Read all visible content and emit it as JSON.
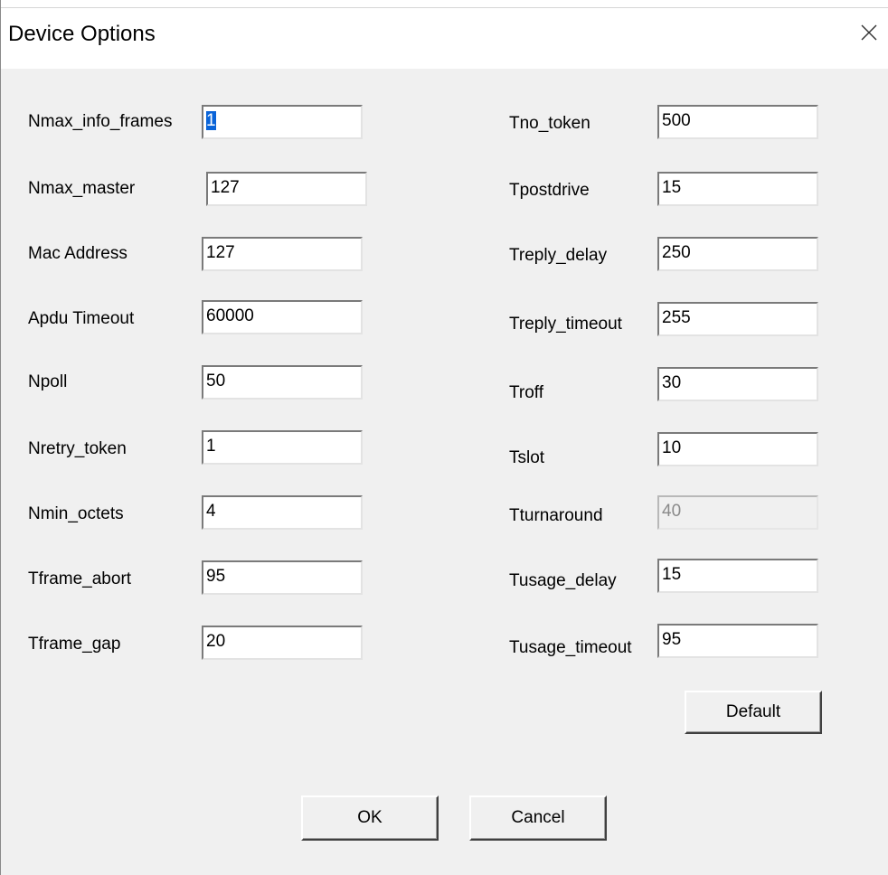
{
  "window": {
    "title": "Device Options",
    "close_icon": "close-icon"
  },
  "left_fields": [
    {
      "label": "Nmax_info_frames",
      "value": "1"
    },
    {
      "label": "Nmax_master",
      "value": "127"
    },
    {
      "label": "Mac Address",
      "value": "127"
    },
    {
      "label": "Apdu Timeout",
      "value": "60000"
    },
    {
      "label": "Npoll",
      "value": "50"
    },
    {
      "label": "Nretry_token",
      "value": "1"
    },
    {
      "label": "Nmin_octets",
      "value": "4"
    },
    {
      "label": "Tframe_abort",
      "value": "95"
    },
    {
      "label": "Tframe_gap",
      "value": "20"
    }
  ],
  "right_fields": [
    {
      "label": "Tno_token",
      "value": "500"
    },
    {
      "label": "Tpostdrive",
      "value": "15"
    },
    {
      "label": "Treply_delay",
      "value": "250"
    },
    {
      "label": "Treply_timeout",
      "value": "255"
    },
    {
      "label": "Troff",
      "value": "30"
    },
    {
      "label": "Tslot",
      "value": "10"
    },
    {
      "label": "Tturnaround",
      "value": "40",
      "disabled": true
    },
    {
      "label": "Tusage_delay",
      "value": "15"
    },
    {
      "label": "Tusage_timeout",
      "value": "95"
    }
  ],
  "buttons": {
    "default_label": "Default",
    "ok_label": "OK",
    "cancel_label": "Cancel"
  },
  "colors": {
    "background": "#f0f0f0",
    "selection": "#0a64d8"
  }
}
